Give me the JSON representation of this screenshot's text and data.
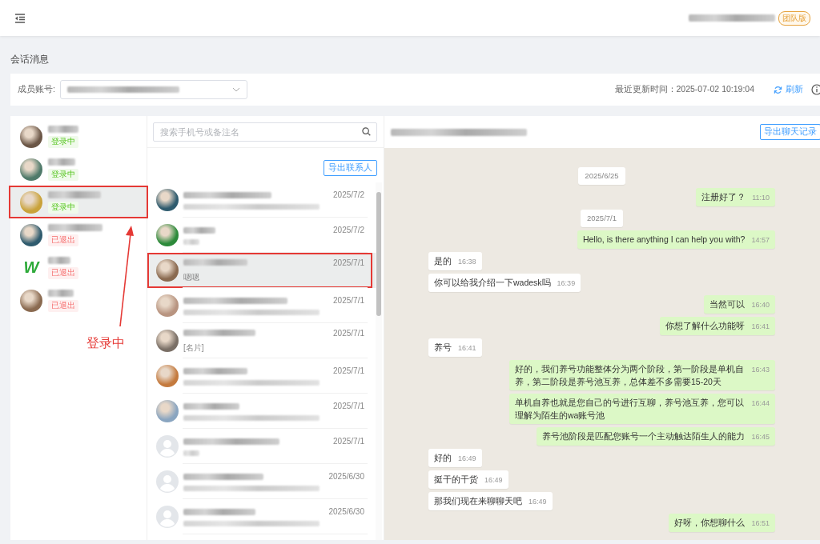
{
  "topbar": {
    "badge": "团队版"
  },
  "page_title": "会话消息",
  "filter": {
    "label": "成员账号:",
    "updated": "最近更新时间：2025-07-02 10:19:04",
    "refresh": "刷新"
  },
  "accounts": [
    {
      "kind": "photo",
      "status": "登录中",
      "online": true,
      "selected": false,
      "highlighted": false
    },
    {
      "kind": "photo",
      "status": "登录中",
      "online": true,
      "selected": false,
      "highlighted": false
    },
    {
      "kind": "photo",
      "status": "登录中",
      "online": true,
      "selected": true,
      "highlighted": true
    },
    {
      "kind": "photo",
      "status": "已退出",
      "online": false,
      "selected": false,
      "highlighted": false
    },
    {
      "kind": "logo",
      "logo_text": "W",
      "status": "已退出",
      "online": false,
      "selected": false,
      "highlighted": false
    },
    {
      "kind": "photo",
      "status": "已退出",
      "online": false,
      "selected": false,
      "highlighted": false
    }
  ],
  "annotation": {
    "label": "登录中"
  },
  "contacts": {
    "search_placeholder": "搜索手机号或备注名",
    "export_button": "导出联系人",
    "items": [
      {
        "kind": "photo",
        "date": "2025/7/2",
        "selected": false,
        "highlighted": false
      },
      {
        "kind": "photo",
        "date": "2025/7/2",
        "selected": false,
        "highlighted": false
      },
      {
        "kind": "photo",
        "date": "2025/7/1",
        "preview": "嗯嗯",
        "selected": true,
        "highlighted": true
      },
      {
        "kind": "photo",
        "date": "2025/7/1",
        "selected": false,
        "highlighted": false
      },
      {
        "kind": "photo",
        "date": "2025/7/1",
        "preview": "[名片]",
        "selected": false,
        "highlighted": false
      },
      {
        "kind": "photo",
        "date": "2025/7/1",
        "selected": false,
        "highlighted": false
      },
      {
        "kind": "photo",
        "date": "2025/7/1",
        "selected": false,
        "highlighted": false
      },
      {
        "kind": "default",
        "date": "2025/7/1",
        "selected": false,
        "highlighted": false
      },
      {
        "kind": "default",
        "date": "2025/6/30",
        "selected": false,
        "highlighted": false
      },
      {
        "kind": "default",
        "date": "2025/6/30",
        "selected": false,
        "highlighted": false
      }
    ]
  },
  "chat": {
    "export_button": "导出聊天记录",
    "messages": [
      {
        "kind": "date",
        "text": "2025/6/25"
      },
      {
        "kind": "out",
        "text": "注册好了？",
        "time": "11:10"
      },
      {
        "kind": "date",
        "text": "2025/7/1"
      },
      {
        "kind": "out",
        "text": "Hello, is there anything I can help you with?",
        "time": "14:57"
      },
      {
        "kind": "in",
        "text": "是的",
        "time": "16:38"
      },
      {
        "kind": "in",
        "text": "你可以给我介绍一下wadesk吗",
        "time": "16:39"
      },
      {
        "kind": "out",
        "text": "当然可以",
        "time": "16:40"
      },
      {
        "kind": "out",
        "text": "你想了解什么功能呀",
        "time": "16:41"
      },
      {
        "kind": "in",
        "text": "养号",
        "time": "16:41"
      },
      {
        "kind": "out",
        "text": "好的，我们养号功能整体分为两个阶段，第一阶段是单机自养，第二阶段是养号池互养，总体差不多需要15-20天",
        "time": "16:43"
      },
      {
        "kind": "out",
        "text": "单机自养也就是您自己的号进行互聊，养号池互养，您可以理解为陌生的wa账号池",
        "time": "16:44"
      },
      {
        "kind": "out",
        "text": "养号池阶段是匹配您账号一个主动触达陌生人的能力",
        "time": "16:45"
      },
      {
        "kind": "in",
        "text": "好的",
        "time": "16:49"
      },
      {
        "kind": "in",
        "text": "挺干的干货",
        "time": "16:49"
      },
      {
        "kind": "in",
        "text": "那我们现在来聊聊天吧",
        "time": "16:49"
      },
      {
        "kind": "out",
        "text": "好呀，你想聊什么",
        "time": "16:51"
      }
    ]
  }
}
